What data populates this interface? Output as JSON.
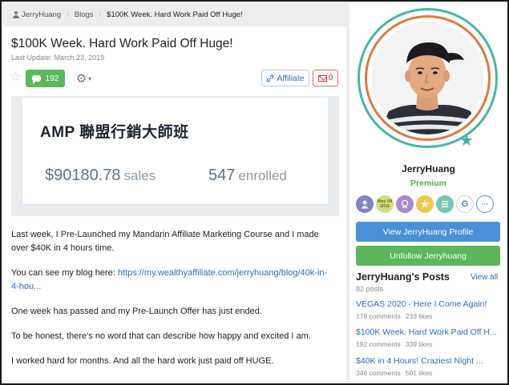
{
  "breadcrumb": {
    "user": "JerryHuang",
    "section": "Blogs",
    "current": "$100K Week. Hard Work Paid Off Huge!"
  },
  "article": {
    "title": "$100K Week. Hard Work Paid Off Huge!",
    "last_update_label": "Last Update:",
    "last_update_date": "March 23, 2019",
    "comments_count": "192",
    "affiliate_label": "Affiliate",
    "mail_count": "0"
  },
  "banner": {
    "title": "AMP 聯盟行銷大師班",
    "sales_value": "$90180.78",
    "sales_unit": "sales",
    "enrolled_value": "547",
    "enrolled_unit": "enrolled"
  },
  "body": {
    "p1": "Last week, I Pre-Launched my Mandarin Affiliate Marketing Course and I made over $40K in 4 hours time.",
    "p2_prefix": "You can see my blog here: ",
    "p2_link": "https://my.wealthyaffiliate.com/jerryhuang/blog/40k-in-4-hou...",
    "p3": "One week has passed and my Pre-Launch Offer has just ended.",
    "p4": "To be honest, there's no word that can describe how happy and excited I am.",
    "p5": "I worked hard for months. And all the hard work just paid off HUGE."
  },
  "profile": {
    "name": "JerryHuang",
    "tier": "Premium",
    "badge_year_text": "May 08 2016",
    "badge_google": "G",
    "badge_more": "···",
    "view_profile_label": "View JerryHuang Profile",
    "unfollow_label": "Unfollow Jerryhuang"
  },
  "posts": {
    "title": "JerryHuang's Posts",
    "view_all": "View all",
    "count": "82 posts",
    "items": [
      {
        "title": "VEGAS 2020 - Here I Come Again!",
        "comments": "178 comments",
        "likes": "233 likes"
      },
      {
        "title": "$100K Week. Hard Work Paid Off H...",
        "comments": "192 comments",
        "likes": "339 likes"
      },
      {
        "title": "$40K in 4 Hours! Craziest Night ...",
        "comments": "346 comments",
        "likes": "501 likes"
      }
    ]
  },
  "colors": {
    "green": "#5cb85c",
    "blue": "#4a90d9",
    "link": "#2a6fb6",
    "ring_outer": "#45b7a6",
    "ring_inner": "#e07a3c"
  }
}
